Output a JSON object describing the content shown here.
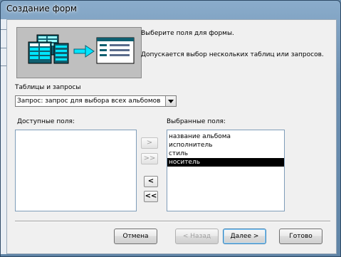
{
  "window": {
    "title": "Создание форм"
  },
  "intro": {
    "line1": "Выберите поля для формы.",
    "line2": "Допускается выбор нескольких таблиц или запросов."
  },
  "source": {
    "label": "Таблицы и запросы",
    "selected": "Запрос: запрос для выбора всех альбомов на к"
  },
  "available": {
    "label": "Доступные поля:",
    "items": []
  },
  "selected_fields": {
    "label": "Выбранные поля:",
    "items": [
      "название альбома",
      "исполнитель",
      "стиль",
      "носитель"
    ],
    "highlighted_index": 3
  },
  "move_buttons": {
    "add_one": ">",
    "add_all": ">>",
    "remove_one": "<",
    "remove_all": "<<"
  },
  "footer": {
    "cancel": "Отмена",
    "back": "< Назад",
    "next": "Далее >",
    "finish": "Готово"
  },
  "colors": {
    "banner_bg": "#bfbfbf",
    "dark_teal": "#0f5f70",
    "bright_cyan": "#00e5ff",
    "selection": "#000000"
  },
  "icons": {
    "banner": "form-wizard-illustration"
  }
}
